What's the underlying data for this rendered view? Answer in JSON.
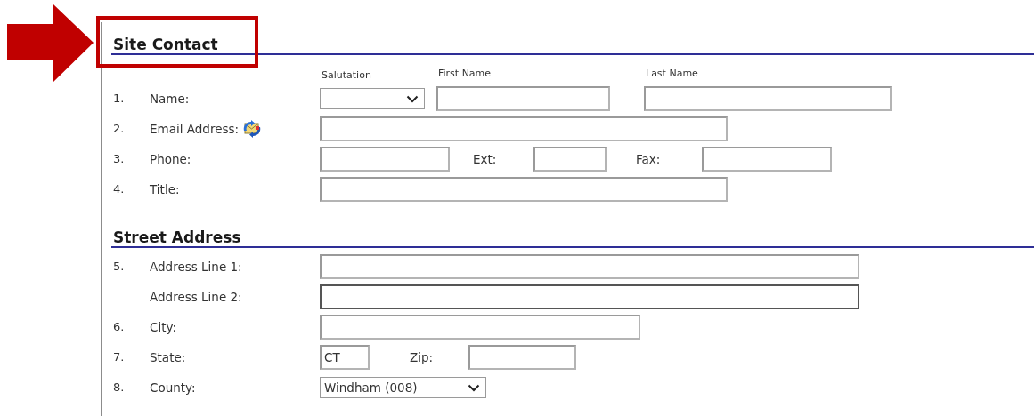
{
  "annotation": {
    "arrow": true,
    "highlight": true
  },
  "sections": [
    {
      "title": "Site Contact",
      "rows": [
        {
          "number": "1.",
          "label": "Name:",
          "fields": [
            {
              "kind": "select",
              "caption": "Salutation",
              "focused": false
            },
            {
              "kind": "text",
              "caption": "First Name",
              "focused": false
            },
            {
              "kind": "text",
              "caption": "Last Name",
              "focused": false
            }
          ]
        },
        {
          "number": "2.",
          "label": "Email Address:",
          "action_icon": true,
          "fields": [
            {
              "kind": "text",
              "focused": false
            }
          ]
        },
        {
          "number": "3.",
          "label": "Phone:",
          "fields": [
            {
              "kind": "text",
              "focused": false
            },
            {
              "kind": "text",
              "label": "Ext:",
              "focused": false
            },
            {
              "kind": "text",
              "label": "Fax:",
              "focused": false
            }
          ]
        },
        {
          "number": "4.",
          "label": "Title:",
          "fields": [
            {
              "kind": "text",
              "focused": false
            }
          ]
        }
      ]
    },
    {
      "title": "Street Address",
      "rows": [
        {
          "number": "5.",
          "label": "Address Line 1:",
          "fields": [
            {
              "kind": "text",
              "focused": false
            }
          ]
        },
        {
          "label": "Address Line 2:",
          "fields": [
            {
              "kind": "text",
              "focused": true
            }
          ]
        },
        {
          "number": "6.",
          "label": "City:",
          "fields": [
            {
              "kind": "text",
              "focused": false
            }
          ]
        },
        {
          "number": "7.",
          "label": "State:",
          "fields": [
            {
              "kind": "text",
              "value": "CT",
              "focused": false
            },
            {
              "kind": "text",
              "label": "Zip:",
              "focused": false
            }
          ]
        },
        {
          "number": "8.",
          "label": "County:",
          "fields": [
            {
              "kind": "select",
              "value": "Windham (008)",
              "focused": false
            }
          ]
        }
      ]
    }
  ]
}
